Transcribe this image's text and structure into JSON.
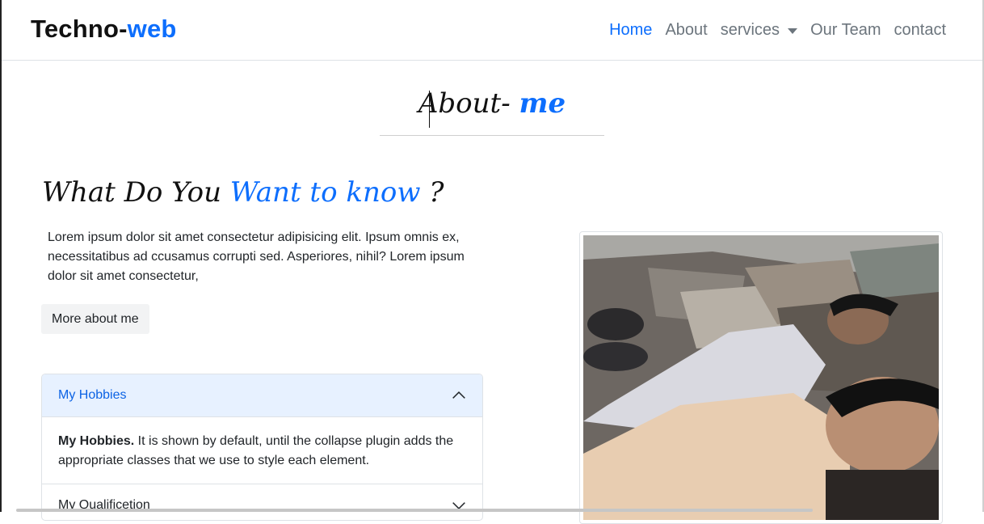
{
  "navbar": {
    "brand_main": "Techno-",
    "brand_accent": "web",
    "links": [
      {
        "label": "Home"
      },
      {
        "label": "About"
      },
      {
        "label": "services"
      },
      {
        "label": "Our Team"
      },
      {
        "label": "contact"
      }
    ]
  },
  "about": {
    "heading_main": "About- ",
    "heading_accent": "me"
  },
  "section": {
    "title_main": "What Do You ",
    "title_accent": "Want to know",
    "title_suffix": " ?",
    "intro": "Lorem ipsum dolor sit amet consectetur adipisicing elit. Ipsum omnis ex, necessitatibus ad ccusamus corrupti sed. Asperiores, nihil? Lorem ipsum dolor sit amet consectetur,",
    "more_button": "More about me"
  },
  "accordion": {
    "items": [
      {
        "title": "My Hobbies",
        "body_bold": "My Hobbies.",
        "body_text": " It is shown by default, until the collapse plugin adds the appropriate classes that we use to style each element."
      },
      {
        "title": "My Qualificetion"
      }
    ]
  },
  "colors": {
    "accent": "#0d6efd",
    "nav_text": "#6c757d",
    "accordion_open_bg": "#e7f1ff"
  },
  "icons": {
    "chevron_up": "chevron-up-icon",
    "chevron_down": "chevron-down-icon",
    "services_caret": "caret-down-icon"
  }
}
